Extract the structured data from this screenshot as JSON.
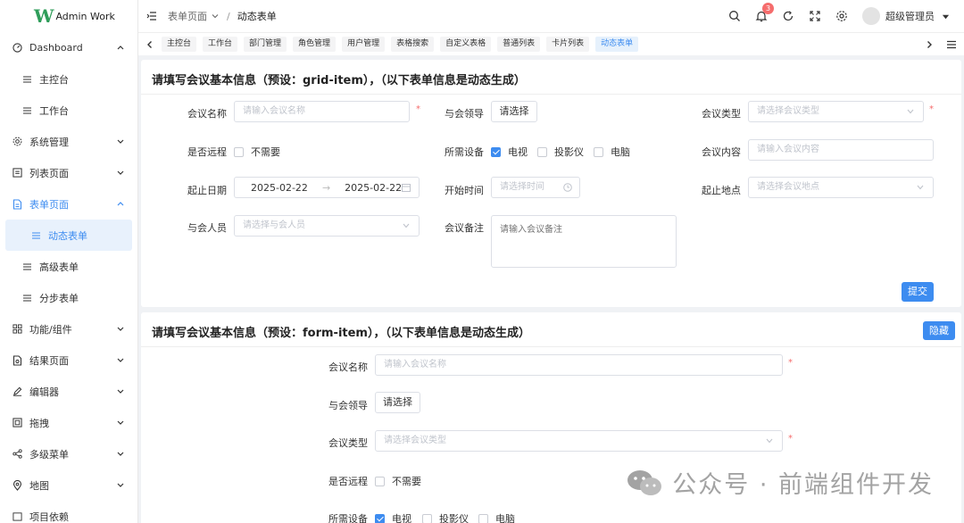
{
  "app": {
    "logo_letter": "W",
    "title": "Admin Work"
  },
  "sidebar": {
    "items": [
      {
        "label": "Dashboard",
        "icon": "dashboard-icon"
      },
      {
        "label": "主控台",
        "icon": "list-icon",
        "sub": true
      },
      {
        "label": "工作台",
        "icon": "list-icon",
        "sub": true
      },
      {
        "label": "系统管理",
        "icon": "gear-icon"
      },
      {
        "label": "列表页面",
        "icon": "table-icon"
      },
      {
        "label": "表单页面",
        "icon": "document-icon"
      },
      {
        "label": "动态表单",
        "icon": "list-icon",
        "sub": true,
        "active": true
      },
      {
        "label": "高级表单",
        "icon": "list-icon",
        "sub": true
      },
      {
        "label": "分步表单",
        "icon": "list-icon",
        "sub": true
      },
      {
        "label": "功能/组件",
        "icon": "grid-icon"
      },
      {
        "label": "结果页面",
        "icon": "result-icon"
      },
      {
        "label": "编辑器",
        "icon": "pen-icon"
      },
      {
        "label": "拖拽",
        "icon": "drag-icon"
      },
      {
        "label": "多级菜单",
        "icon": "share-icon"
      },
      {
        "label": "地图",
        "icon": "location-icon"
      },
      {
        "label": "项目依赖",
        "icon": "package-icon"
      }
    ]
  },
  "header": {
    "breadcrumb_parent": "表单页面",
    "breadcrumb_current": "动态表单",
    "notification_count": "3",
    "username": "超级管理员"
  },
  "tabs": [
    "主控台",
    "工作台",
    "部门管理",
    "角色管理",
    "用户管理",
    "表格搜索",
    "自定义表格",
    "普通列表",
    "卡片列表",
    "动态表单"
  ],
  "card1": {
    "title": "请填写会议基本信息（预设：grid-item），（以下表单信息是动态生成）",
    "fields": {
      "meeting_name_label": "会议名称",
      "meeting_name_placeholder": "请输入会议名称",
      "leader_label": "与会领导",
      "leader_button": "请选择",
      "type_label": "会议类型",
      "type_placeholder": "请选择会议类型",
      "remote_label": "是否远程",
      "remote_option": "不需要",
      "device_label": "所需设备",
      "device_tv": "电视",
      "device_projector": "投影仪",
      "device_pc": "电脑",
      "content_label": "会议内容",
      "content_placeholder": "请输入会议内容",
      "date_label": "起止日期",
      "date_start": "2025-02-22",
      "date_end": "2025-02-22",
      "start_time_label": "开始时间",
      "start_time_placeholder": "请选择时间",
      "place_label": "起止地点",
      "place_placeholder": "请选择会议地点",
      "attendees_label": "与会人员",
      "attendees_placeholder": "请选择与会人员",
      "remark_label": "会议备注",
      "remark_placeholder": "请输入会议备注",
      "submit": "提交"
    }
  },
  "card2": {
    "title": "请填写会议基本信息（预设：form-item），（以下表单信息是动态生成）",
    "hide_button": "隐藏",
    "fields": {
      "meeting_name_label": "会议名称",
      "meeting_name_placeholder": "请输入会议名称",
      "leader_label": "与会领导",
      "leader_button": "请选择",
      "type_label": "会议类型",
      "type_placeholder": "请选择会议类型",
      "remote_label": "是否远程",
      "remote_option": "不需要",
      "device_label": "所需设备",
      "device_tv": "电视",
      "device_projector": "投影仪",
      "device_pc": "电脑"
    }
  },
  "watermark": "公众号 · 前端组件开发",
  "colors": {
    "primary": "#3d8cf0",
    "danger": "#f56c6c",
    "brand": "#2f9d5a"
  }
}
